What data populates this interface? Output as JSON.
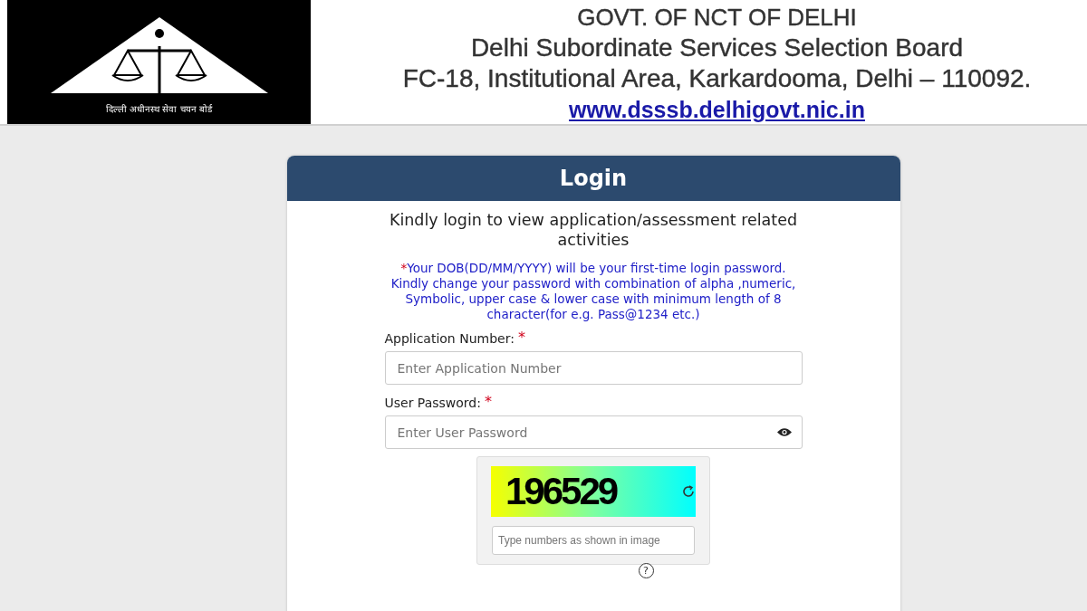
{
  "header": {
    "logo_caption": "दिल्ली अधीनस्थ सेवा चयन बोर्ड",
    "lines": [
      "GOVT. OF NCT OF DELHI",
      "Delhi Subordinate Services Selection Board",
      "FC-18, Institutional Area, Karkardooma, Delhi – 110092."
    ],
    "link": "www.dsssb.delhigovt.nic.in"
  },
  "login": {
    "title": "Login",
    "intro": "Kindly login to view application/assessment related activities",
    "note_mark": "*",
    "note": "Your DOB(DD/MM/YYYY) will be your first-time login password. Kindly change your password with combination of alpha ,numeric, Symbolic, upper case & lower case with minimum length of 8 character(for e.g. Pass@1234 etc.)",
    "fields": [
      {
        "label": "Application Number:",
        "required": true,
        "placeholder": "Enter Application Number",
        "kind": "text"
      },
      {
        "label": "User Password:",
        "required": true,
        "placeholder": "Enter User Password",
        "kind": "password"
      }
    ],
    "captcha": {
      "code": "196529",
      "placeholder": "Type numbers as shown in image",
      "help": "?"
    }
  }
}
